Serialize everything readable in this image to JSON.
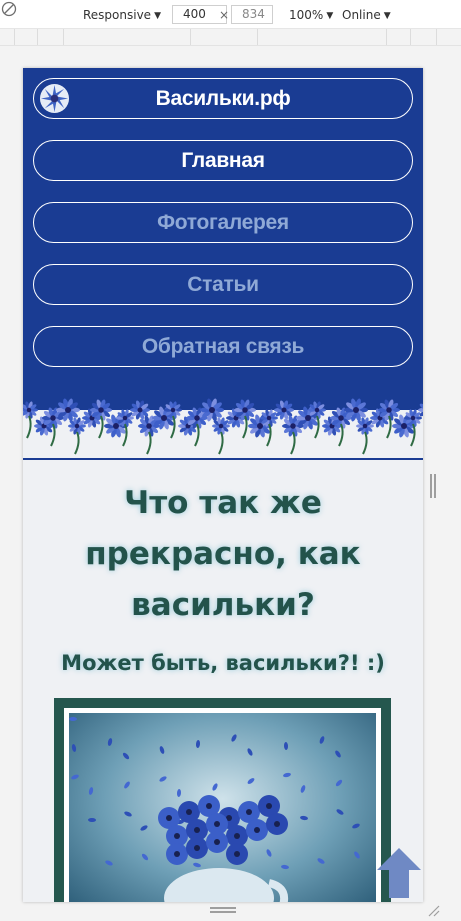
{
  "devtools": {
    "device": "Responsive",
    "width": "400",
    "height": "834",
    "separator": "×",
    "zoom": "100%",
    "throttling": "Online",
    "arrow": "▼",
    "rotate_icon": "rotate-icon"
  },
  "site": {
    "brand": "Васильки.рф",
    "nav": [
      "Главная",
      "Фотогалерея",
      "Статьи",
      "Обратная связь"
    ],
    "active_nav": "Главная",
    "hero_title": "Что так же прекрасно, как васильки?",
    "hero_subtitle": "Может быть, васильки?! :)",
    "colors": {
      "header_bg": "#1a3c93",
      "inactive_link": "#8fa9d6",
      "heading": "#23534b",
      "page_bg": "#eff1f4",
      "frame": "#25574e",
      "scroll_top_arrow": "#6f89c4"
    },
    "icons": [
      "cornflower-logo-icon",
      "scroll-to-top-arrow-icon"
    ]
  }
}
